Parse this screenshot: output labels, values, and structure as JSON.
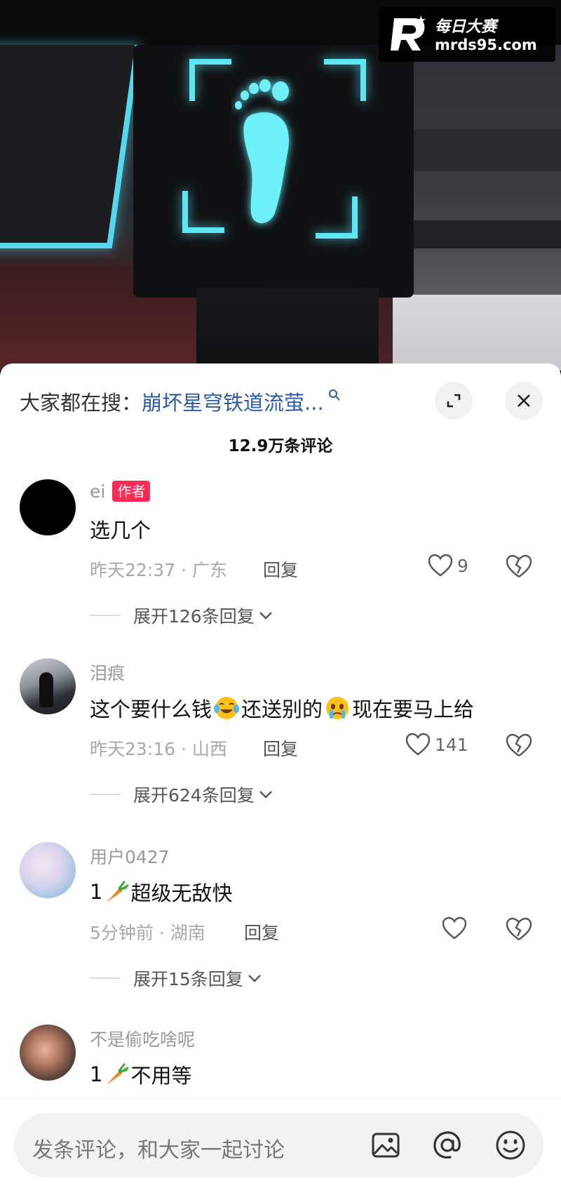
{
  "watermark": {
    "logo_letter": "R",
    "cn": "每日大赛",
    "url": "mrds95.com"
  },
  "search": {
    "prefix": "大家都在搜：",
    "term": "崩坏星穹铁道流萤..."
  },
  "comment_count": "12.9万条评论",
  "comments": [
    {
      "user": "ei",
      "badge": "作者",
      "text": "选几个",
      "time_loc": "昨天22:37 · 广东",
      "reply": "回复",
      "likes": "9",
      "expand": "展开126条回复"
    },
    {
      "user": "泪痕",
      "text_parts": [
        "这个要什么钱",
        "还送别的",
        "现在要马上给"
      ],
      "emojis": [
        "laughing-crying-emoji",
        "tearful-emoji"
      ],
      "time_loc": "昨天23:16 · 山西",
      "reply": "回复",
      "likes": "141",
      "expand": "展开624条回复"
    },
    {
      "user": "用户0427",
      "text_parts": [
        "1",
        "超级无敌快"
      ],
      "emojis": [
        "carrot-emoji"
      ],
      "time_loc": "5分钟前 · 湖南",
      "reply": "回复",
      "likes": "",
      "expand": "展开15条回复"
    },
    {
      "user": "不是偷吃啥呢",
      "text_parts": [
        "1",
        "不用等"
      ],
      "emojis": [
        "carrot-emoji"
      ]
    }
  ],
  "input": {
    "placeholder": "发条评论，和大家一起讨论"
  },
  "colors": {
    "accent_red": "#fe2c55",
    "search_blue": "#2a5aa8",
    "neon_cyan": "#5ee6f2"
  }
}
